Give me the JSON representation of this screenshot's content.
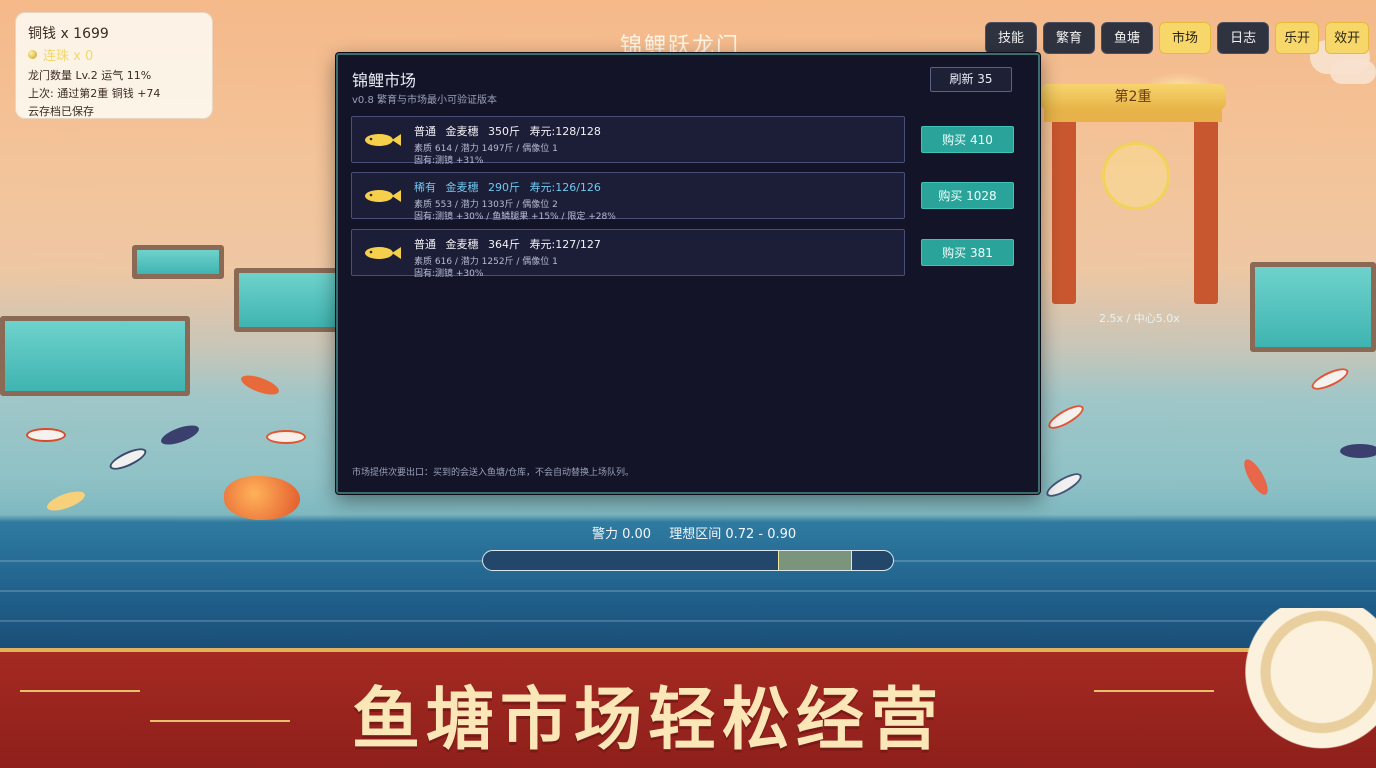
{
  "stats": {
    "coins": "铜钱 x 1699",
    "pearls": "连珠 x 0",
    "level": "龙门数量 Lv.2  运气 11%",
    "last": "上次: 通过第2重 铜钱 +74",
    "save": "云存档已保存"
  },
  "header": {
    "title": "锦鲤跃龙门"
  },
  "nav": [
    {
      "label": "技能"
    },
    {
      "label": "繁育"
    },
    {
      "label": "鱼塘"
    },
    {
      "label": "市场"
    },
    {
      "label": "日志"
    },
    {
      "label": "乐开"
    },
    {
      "label": "效开"
    }
  ],
  "gate": {
    "sign": "第2重",
    "multiplier": "2.5x / 中心5.0x"
  },
  "market": {
    "title": "锦鲤市场",
    "subtitle": "v0.8 繁育与市场最小可验证版本",
    "refresh": "刷新 35",
    "note": "市场提供次要出口：买到的会送入鱼塘/仓库，不会自动替换上场队列。",
    "listings": [
      {
        "rarity": "普通",
        "breed": "金麦穗",
        "weight": "350斤",
        "life": "寿元:128/128",
        "detail1": "素质 614 / 潜力 1497斤 / 偶像位 1",
        "detail2": "固有:测镜 +31%",
        "buy": "购买 410",
        "rare": false
      },
      {
        "rarity": "稀有",
        "breed": "金麦穗",
        "weight": "290斤",
        "life": "寿元:126/126",
        "detail1": "素质 553 / 潜力 1303斤 / 偶像位 2",
        "detail2": "固有:测镜 +30% / 鱼鳞腿果 +15% / 限定 +28%",
        "buy": "购买 1028",
        "rare": true
      },
      {
        "rarity": "普通",
        "breed": "金麦穗",
        "weight": "364斤",
        "life": "寿元:127/127",
        "detail1": "素质 616 / 潜力 1252斤 / 偶像位 1",
        "detail2": "固有:测镜 +30%",
        "buy": "购买 381",
        "rare": false
      }
    ]
  },
  "meter": {
    "power": "警力 0.00",
    "range": "理想区间 0.72 - 0.90",
    "value": 0.0,
    "zone_start": 0.72,
    "zone_end": 0.9
  },
  "banner": {
    "text": "鱼塘市场轻松经营"
  },
  "colors": {
    "accent_gold": "#f8d76a",
    "buy_teal": "#2aa39a",
    "rare_blue": "#6fc7ef",
    "banner_red": "#a42a22"
  }
}
